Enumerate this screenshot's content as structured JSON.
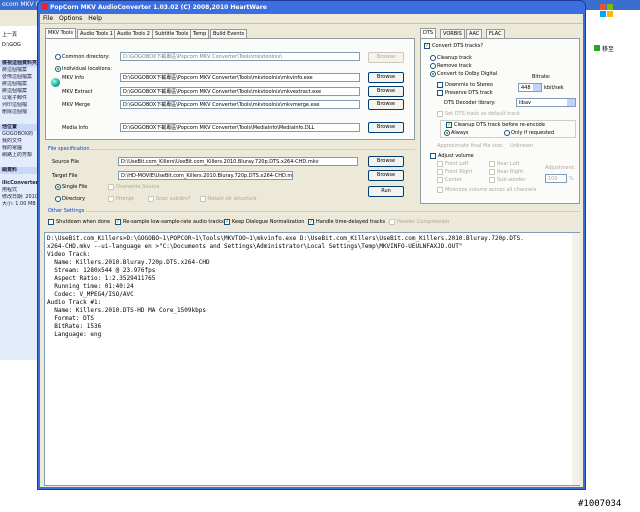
{
  "background": {
    "title": "ocom MKV Converter",
    "menu": "上一頁",
    "address_fragment": "D:\\GOG",
    "side_items": [
      "檢視這個資料夾",
      "將這個檔案",
      "發佈這個檔案",
      "將這個檔案",
      "將這個檔案",
      "以電子郵件",
      "列印這個檔",
      "刪除這個檔",
      "他位置",
      "GOGOBOX的",
      "我的文件",
      "我的電腦",
      "網路上的芳鄰",
      "細資料",
      "ilicConverter",
      "用程式",
      "修改日期: 2010年",
      "大小: 1.00 MB"
    ],
    "right_button": "移至",
    "watermark": "#1007034"
  },
  "window": {
    "title": "PopCorn MKV AudioConverter 1.03.02 (C) 2008,2010 HeartWare",
    "menu": [
      "File",
      "Options",
      "Help"
    ]
  },
  "left_tabs": [
    "MKV Tools",
    "Audio Tools 1",
    "Audio Tools 2",
    "Subtitle Tools",
    "Temp",
    "Build Events"
  ],
  "mkv_tools": {
    "common_dir_label": "Common directory:",
    "common_dir_value": "D:\\GOGOBOX下載專區\\Popcorn MKV Converter\\Tools\\mkvtoolnix\\",
    "browse": "Browse",
    "individual_label": "Individual locations:",
    "rows": [
      {
        "label": "MKV Info",
        "value": "D:\\GOGOBOX下載專區\\Popcorn MKV Converter\\Tools\\mkvtoolnix\\mkvinfo.exe"
      },
      {
        "label": "MKV Extract",
        "value": "D:\\GOGOBOX下載專區\\Popcorn MKV Converter\\Tools\\mkvtoolnix\\mkvextract.exe"
      },
      {
        "label": "MKV Merge",
        "value": "D:\\GOGOBOX下載專區\\Popcorn MKV Converter\\Tools\\mkvtoolnix\\mkvmerge.exe"
      }
    ],
    "media_info_label": "Media Info",
    "media_info_value": "D:\\GOGOBOX下載專區\\Popcorn MKV Converter\\Tools\\MediaInfo\\MediaInfo.DLL"
  },
  "file_spec": {
    "title": "File specification",
    "source_label": "Source File",
    "source_value": "D:\\UseBit.com_Killers\\UseBit.com_Killers.2010.Bluray.720p.DTS.x264-CHD.mkv",
    "target_label": "Target File",
    "target_value": "D:\\HD-MOVIE\\UseBit.com_Killers.2010.Bluray.720p.DTS.x264-CHD.mkv",
    "single_file": "Single File",
    "overwrite": "Overwrite Source",
    "directory": "Directory",
    "prompt": "Prompt",
    "scan_subdirs": "Scan subdirs?",
    "retain_dir": "Retain dir structure",
    "run": "Run"
  },
  "other_settings": {
    "title": "Other Settings",
    "items": [
      "Shutdown when done",
      "Re-sample low-sample-rate audio tracks",
      "Keep Dialogue Normalization",
      "Handle time-delayed tracks",
      "Header Compression"
    ]
  },
  "right_tabs": [
    "DTS",
    "VORBIS",
    "AAC",
    "FLAC"
  ],
  "dts": {
    "convert": "Convert DTS tracks?",
    "cleanup": "Cleanup track",
    "remove": "Remove track",
    "convert_dolby": "Convert to Dolby Digital",
    "bitrate_label": "Bitrate:",
    "downmix": "Downmix to Stereo",
    "bitrate_value": "448",
    "kbit": "kbit/sek",
    "preserve": "Preserve DTS track",
    "decoder_label": "DTS Decoder library:",
    "decoder_value": "libav",
    "set_default": "Set DTS track as default track",
    "cleanup_reencode": "Cleanup DTS track before re-encode",
    "always": "Always",
    "only_if": "Only if requested",
    "approx_label": "Approximate final file size:",
    "approx_value": "Unknown",
    "adjust_volume": "Adjust volume",
    "front_left": "Front Left",
    "rear_left": "Rear Left",
    "front_right": "Front Right",
    "rear_right": "Rear Right",
    "center": "Center",
    "subwoofer": "Sub-woofer",
    "adjustment_label": "Adjustment:",
    "adjustment_value": "100",
    "percent": "%",
    "minimize": "Minimize volume across all channels"
  },
  "console_lines": [
    "D:\\UseBit.com_Killers>D:\\GOGOBO~1\\POPCOR~1\\Tools\\MKVTOO~1\\mkvinfo.exe D:\\UseBit.com_Killers\\UseBit.com_Killers.2010.Bluray.720p.DTS.",
    "x264-CHD.mkv --ui-language en >\"C:\\Documents and Settings\\Administrator\\Local Settings\\Temp\\MKVINFO-UEULNFAXJD.OUT\"",
    "",
    "Video Track:",
    "  Name: Killers.2010.Bluray.720p.DTS.x264-CHD",
    "  Stream: 1280x544 @ 23.976fps",
    "  Aspect Ratio: 1:2.3529411765",
    "  Running time: 01:40:24",
    "  Codec: V_MPEG4/ISO/AVC",
    "Audio Track #1:",
    "  Name: Killers.2010.DTS-HD MA Core_1509kbps",
    "  Format: DTS",
    "  BitRate: 1536",
    "  Language: eng"
  ]
}
